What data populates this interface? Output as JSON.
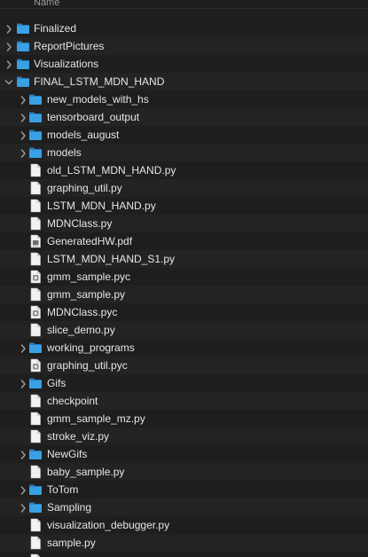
{
  "header": {
    "name_column": "Name"
  },
  "colors": {
    "background": "#1e1e1e",
    "alt_row": "#232323",
    "folder_blue": "#39a0e6",
    "text": "#e6e6e6"
  },
  "rows": [
    {
      "label": "Finalized",
      "kind": "folder",
      "level": 0,
      "expanded": false
    },
    {
      "label": "ReportPictures",
      "kind": "folder",
      "level": 0,
      "expanded": false
    },
    {
      "label": "Visualizations",
      "kind": "folder",
      "level": 0,
      "expanded": false
    },
    {
      "label": "FINAL_LSTM_MDN_HAND",
      "kind": "folder",
      "level": 0,
      "expanded": true
    },
    {
      "label": "new_models_with_hs",
      "kind": "folder",
      "level": 1,
      "expanded": false
    },
    {
      "label": "tensorboard_output",
      "kind": "folder",
      "level": 1,
      "expanded": false
    },
    {
      "label": "models_august",
      "kind": "folder",
      "level": 1,
      "expanded": false
    },
    {
      "label": "models",
      "kind": "folder",
      "level": 1,
      "expanded": false
    },
    {
      "label": "old_LSTM_MDN_HAND.py",
      "kind": "file",
      "level": 1
    },
    {
      "label": "graphing_util.py",
      "kind": "file",
      "level": 1
    },
    {
      "label": "LSTM_MDN_HAND.py",
      "kind": "file",
      "level": 1
    },
    {
      "label": "MDNClass.py",
      "kind": "file",
      "level": 1
    },
    {
      "label": "GeneratedHW.pdf",
      "kind": "pdf",
      "level": 1
    },
    {
      "label": "LSTM_MDN_HAND_S1.py",
      "kind": "file",
      "level": 1
    },
    {
      "label": "gmm_sample.pyc",
      "kind": "binary",
      "level": 1
    },
    {
      "label": "gmm_sample.py",
      "kind": "file",
      "level": 1
    },
    {
      "label": "MDNClass.pyc",
      "kind": "binary",
      "level": 1
    },
    {
      "label": "slice_demo.py",
      "kind": "file",
      "level": 1
    },
    {
      "label": "working_programs",
      "kind": "folder",
      "level": 1,
      "expanded": false
    },
    {
      "label": "graphing_util.pyc",
      "kind": "binary",
      "level": 1
    },
    {
      "label": "Gifs",
      "kind": "folder",
      "level": 1,
      "expanded": false
    },
    {
      "label": "checkpoint",
      "kind": "file",
      "level": 1
    },
    {
      "label": "gmm_sample_mz.py",
      "kind": "file",
      "level": 1
    },
    {
      "label": "stroke_viz.py",
      "kind": "file",
      "level": 1
    },
    {
      "label": "NewGifs",
      "kind": "folder",
      "level": 1,
      "expanded": false
    },
    {
      "label": "baby_sample.py",
      "kind": "file",
      "level": 1
    },
    {
      "label": "ToTom",
      "kind": "folder",
      "level": 1,
      "expanded": false
    },
    {
      "label": "Sampling",
      "kind": "folder",
      "level": 1,
      "expanded": false
    },
    {
      "label": "visualization_debugger.py",
      "kind": "file",
      "level": 1
    },
    {
      "label": "sample.py",
      "kind": "file",
      "level": 1
    },
    {
      "label": "",
      "kind": "file",
      "level": 1
    }
  ]
}
